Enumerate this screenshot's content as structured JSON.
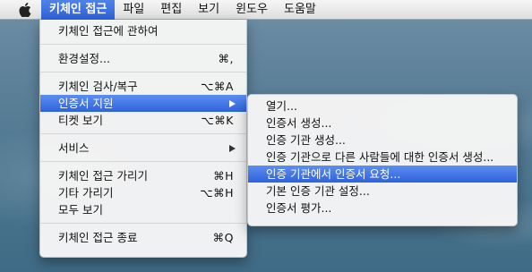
{
  "menubar": {
    "apple_icon": "apple-icon",
    "items": [
      {
        "label": "키체인 접근",
        "active": true
      },
      {
        "label": "파일"
      },
      {
        "label": "편집"
      },
      {
        "label": "보기"
      },
      {
        "label": "윈도우"
      },
      {
        "label": "도움말"
      }
    ]
  },
  "main_menu": {
    "about": "키체인 접근에 관하여",
    "preferences": {
      "label": "환경설정...",
      "shortcut": "⌘,"
    },
    "first_aid": {
      "label": "키체인 검사/복구",
      "shortcut": "⌥⌘A"
    },
    "cert_assistant": {
      "label": "인증서 지원"
    },
    "ticket_viewer": {
      "label": "티켓 보기",
      "shortcut": "⌥⌘K"
    },
    "services": {
      "label": "서비스"
    },
    "hide": {
      "label": "키체인 접근 가리기",
      "shortcut": "⌘H"
    },
    "hide_others": {
      "label": "기타 가리기",
      "shortcut": "⌥⌘H"
    },
    "show_all": {
      "label": "모두 보기"
    },
    "quit": {
      "label": "키체인 접근 종료",
      "shortcut": "⌘Q"
    }
  },
  "sub_menu": {
    "items": [
      "열기...",
      "인증서 생성...",
      "인증 기관 생성...",
      "인증 기관으로 다른 사람들에 대한 인증서 생성...",
      "인증 기관에서 인증서 요청...",
      "기본 인증 기관 설정...",
      "인증서 평가..."
    ],
    "highlighted_index": 4
  },
  "colors": {
    "highlight": "#2e63dc",
    "menubar": "#e8e8e8"
  }
}
